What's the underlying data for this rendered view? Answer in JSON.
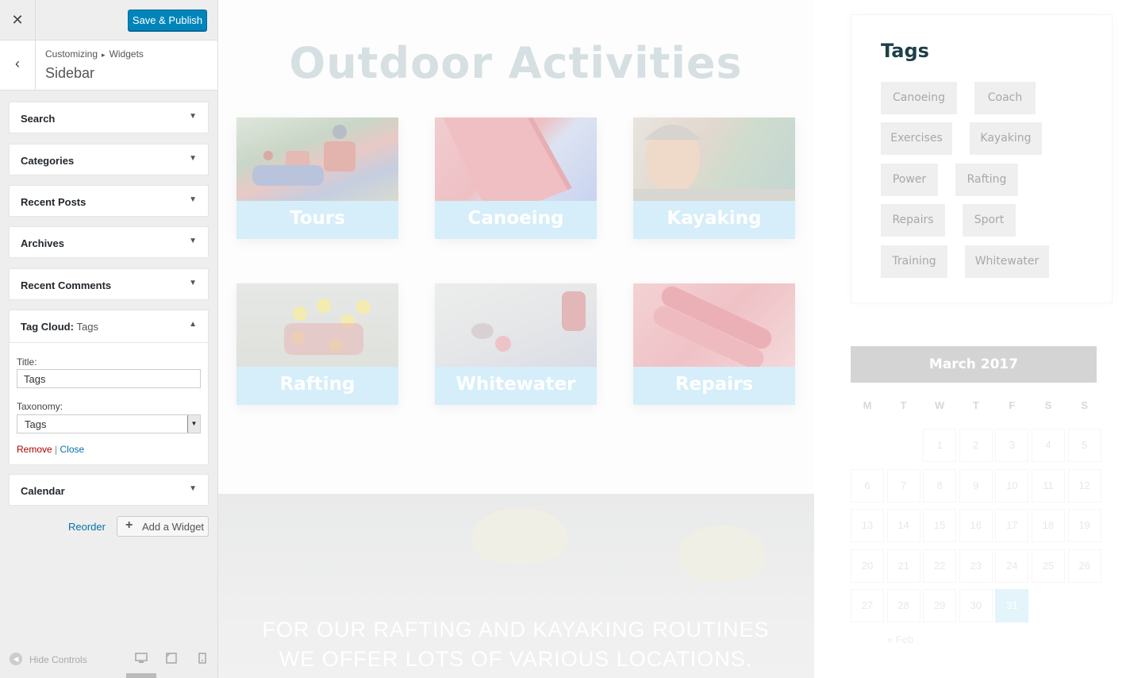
{
  "panel": {
    "close_icon": "close-icon",
    "publish_label": "Save & Publish",
    "breadcrumb": [
      "Customizing",
      "Widgets"
    ],
    "breadcrumb_separator": "▸",
    "section_title": "Sidebar",
    "widgets_top": [
      "Search",
      "Categories",
      "Recent Posts",
      "Archives",
      "Recent Comments"
    ],
    "tag_widget": {
      "title_prefix": "Tag Cloud:",
      "title_value": "Tags",
      "field_title_label": "Title:",
      "field_title_value": "Tags",
      "field_taxonomy_label": "Taxonomy:",
      "field_taxonomy_value": "Tags",
      "remove_label": "Remove",
      "separator": "|",
      "close_label": "Close"
    },
    "widgets_bottom": [
      "Calendar"
    ],
    "reorder_label": "Reorder",
    "add_widget_label": "Add a Widget",
    "hide_controls_label": "Hide Controls",
    "devices": [
      "desktop",
      "tablet",
      "mobile"
    ],
    "accent_color": "#0085ba"
  },
  "preview": {
    "main_title": "Outdoor Activities",
    "tiles": [
      "Tours",
      "Canoeing",
      "Kayaking",
      "Rafting",
      "Whitewater",
      "Repairs"
    ],
    "banner_text": "FOR OUR RAFTING AND KAYAKING ROUTINES WE OFFER LOTS OF VARIOUS LOCATIONS.",
    "tags_heading": "Tags",
    "tags": [
      "Canoeing",
      "Coach",
      "Exercises",
      "Kayaking",
      "Power",
      "Rafting",
      "Repairs",
      "Sport",
      "Training",
      "Whitewater"
    ],
    "calendar": {
      "month": "March 2017",
      "weekdays": [
        "M",
        "T",
        "W",
        "T",
        "F",
        "S",
        "S"
      ],
      "weeks": [
        [
          "",
          "",
          "1",
          "2",
          "3",
          "4",
          "5"
        ],
        [
          "6",
          "7",
          "8",
          "9",
          "10",
          "11",
          "12"
        ],
        [
          "13",
          "14",
          "15",
          "16",
          "17",
          "18",
          "19"
        ],
        [
          "20",
          "21",
          "22",
          "23",
          "24",
          "25",
          "26"
        ],
        [
          "27",
          "28",
          "29",
          "30",
          "31",
          "",
          ""
        ]
      ],
      "today": "31",
      "prev_link": "« Feb"
    }
  }
}
